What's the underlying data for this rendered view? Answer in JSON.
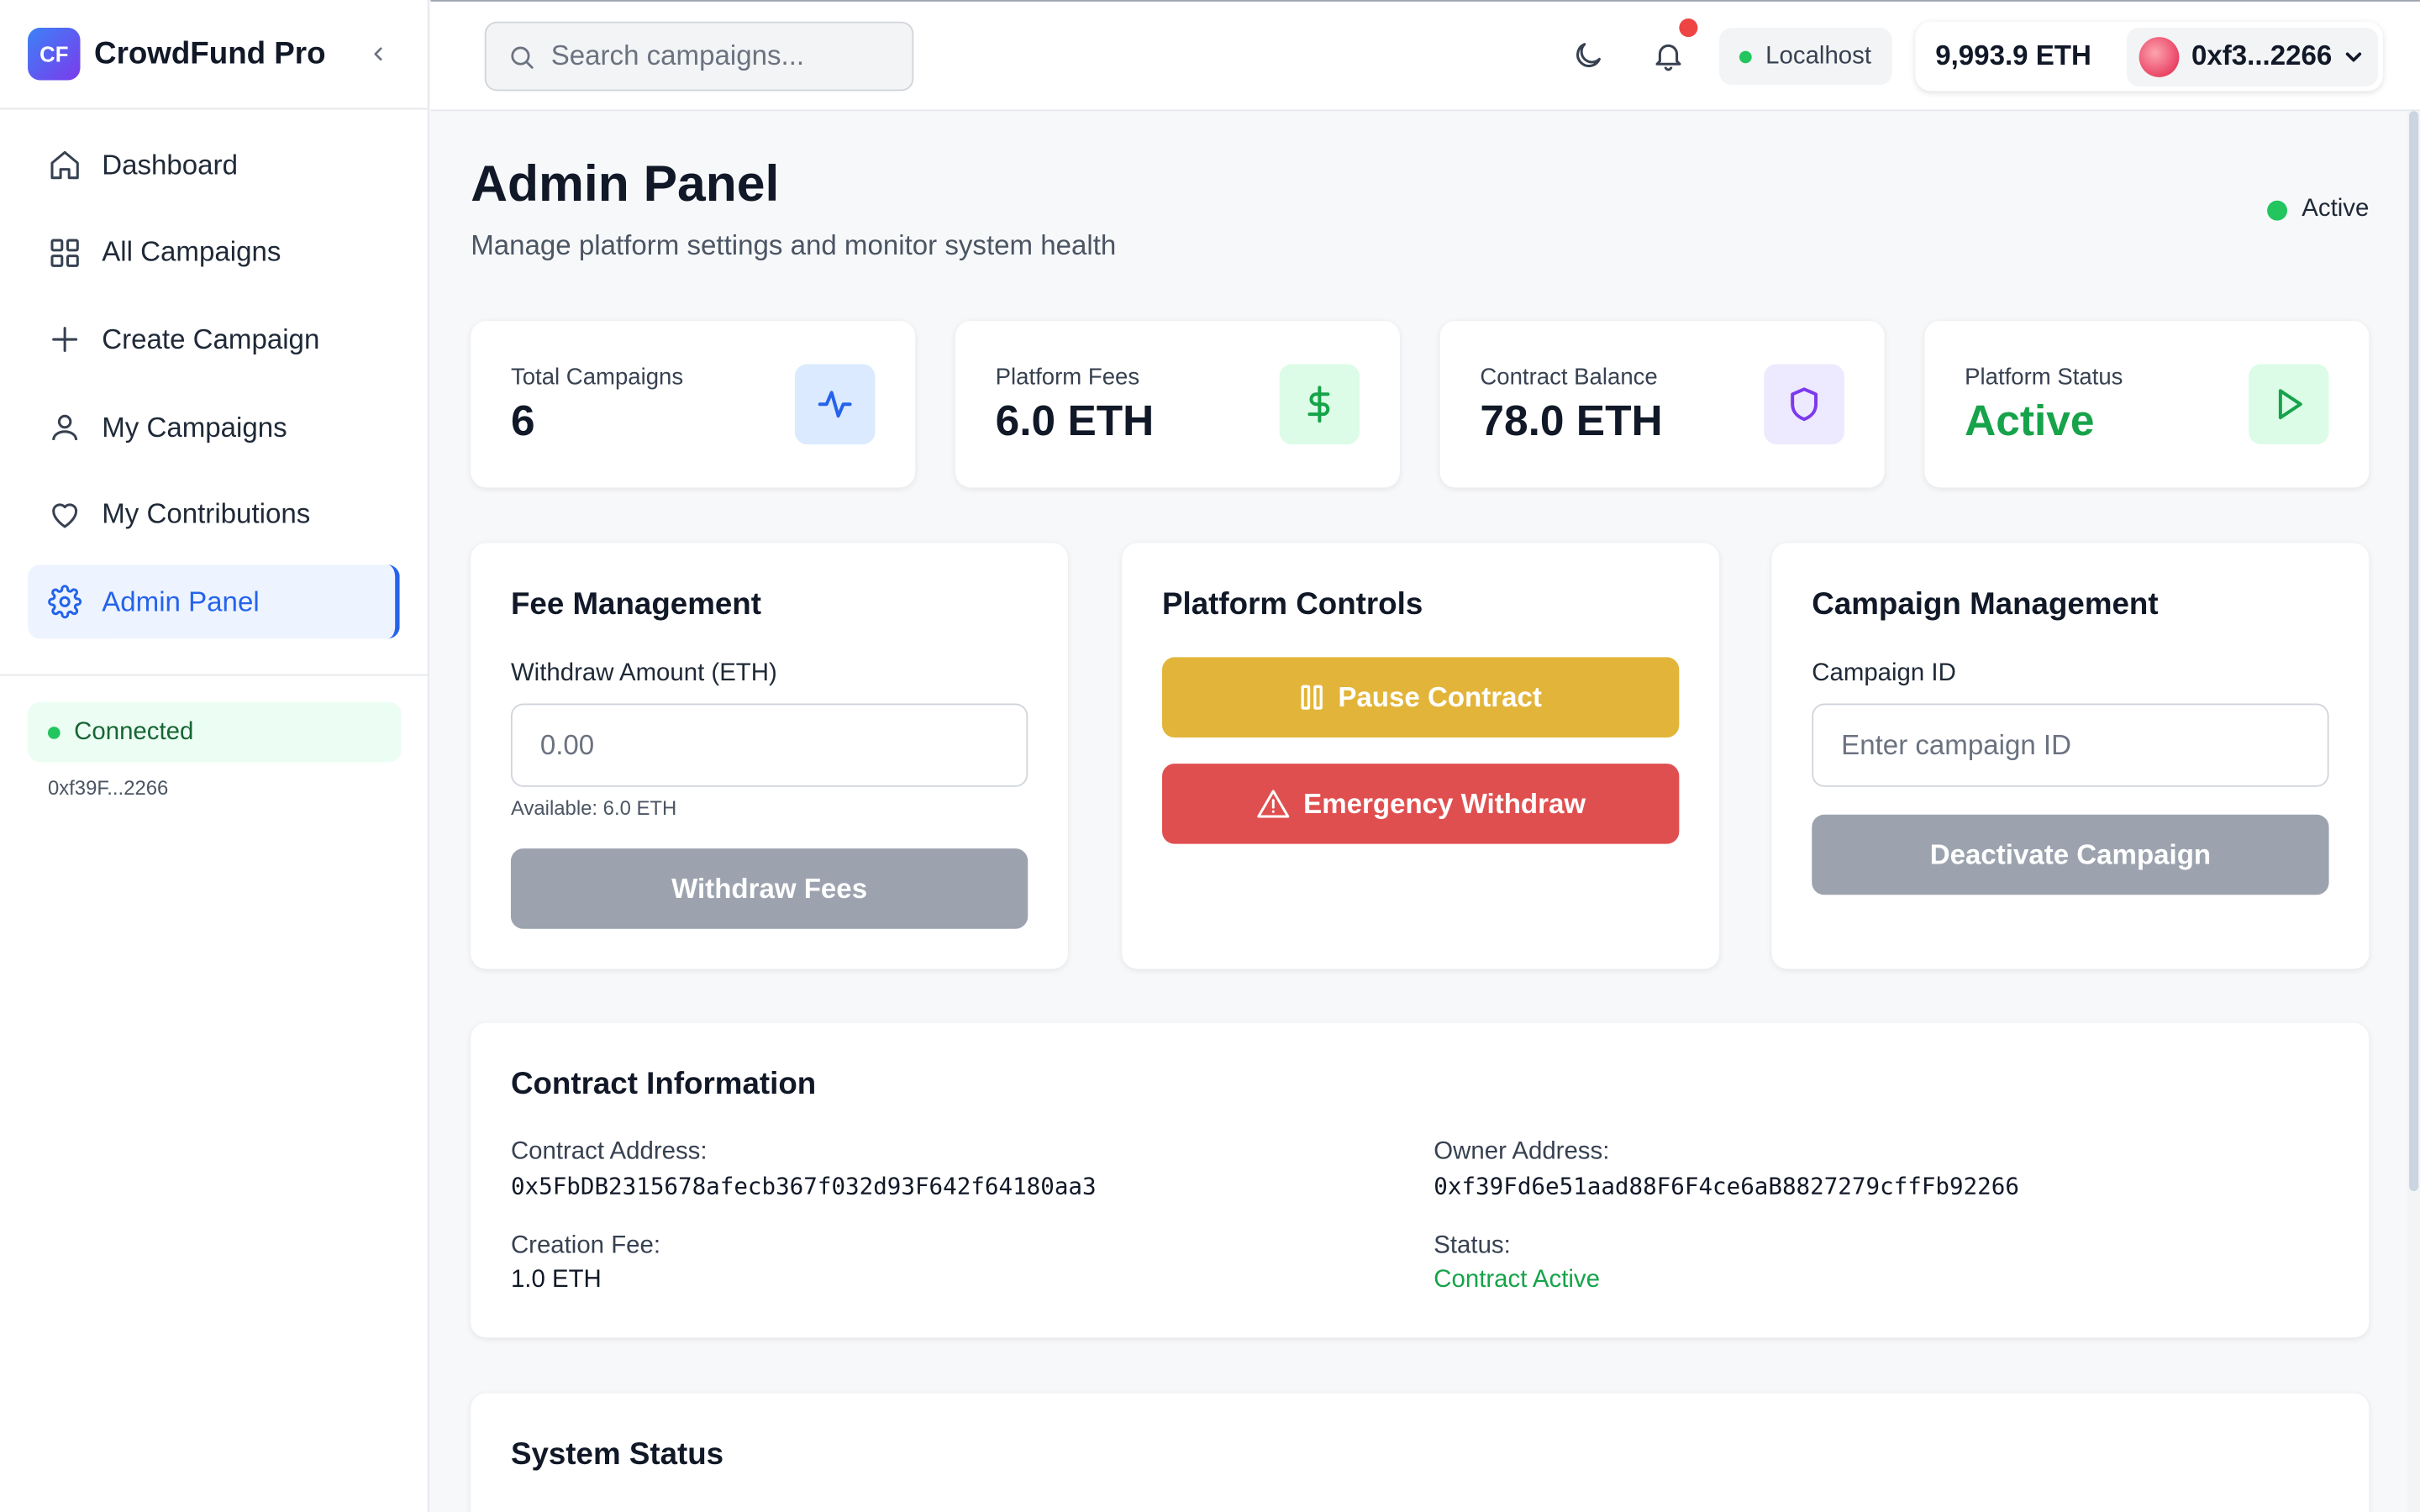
{
  "brand": {
    "logo_text": "CF",
    "name": "CrowdFund Pro"
  },
  "sidebar": {
    "items": [
      {
        "label": "Dashboard",
        "icon": "home-icon"
      },
      {
        "label": "All Campaigns",
        "icon": "grid-icon"
      },
      {
        "label": "Create Campaign",
        "icon": "plus-icon"
      },
      {
        "label": "My Campaigns",
        "icon": "user-icon"
      },
      {
        "label": "My Contributions",
        "icon": "heart-icon"
      },
      {
        "label": "Admin Panel",
        "icon": "gear-icon",
        "active": true
      }
    ],
    "connection_status": "Connected",
    "connected_address": "0xf39F...2266"
  },
  "topbar": {
    "search_placeholder": "Search campaigns...",
    "network": "Localhost",
    "balance": "9,993.9 ETH",
    "account": "0xf3...2266"
  },
  "page": {
    "title": "Admin Panel",
    "subtitle": "Manage platform settings and monitor system health",
    "status": "Active"
  },
  "stats": [
    {
      "label": "Total Campaigns",
      "value": "6",
      "icon": "activity-icon",
      "icon_color": "#2563eb",
      "icon_bg": "#dbeafe"
    },
    {
      "label": "Platform Fees",
      "value": "6.0 ETH",
      "icon": "dollar-icon",
      "icon_color": "#16a34a",
      "icon_bg": "#dcfce7"
    },
    {
      "label": "Contract Balance",
      "value": "78.0 ETH",
      "icon": "shield-icon",
      "icon_color": "#7c3aed",
      "icon_bg": "#ede9fe"
    },
    {
      "label": "Platform Status",
      "value": "Active",
      "icon": "play-icon",
      "icon_color": "#16a34a",
      "icon_bg": "#dcfce7"
    }
  ],
  "fee_management": {
    "title": "Fee Management",
    "field_label": "Withdraw Amount (ETH)",
    "placeholder": "0.00",
    "available": "Available: 6.0 ETH",
    "button": "Withdraw Fees"
  },
  "platform_controls": {
    "title": "Platform Controls",
    "pause_button": "Pause Contract",
    "emergency_button": "Emergency Withdraw"
  },
  "campaign_management": {
    "title": "Campaign Management",
    "field_label": "Campaign ID",
    "placeholder": "Enter campaign ID",
    "button": "Deactivate Campaign"
  },
  "contract_info": {
    "title": "Contract Information",
    "contract_address_label": "Contract Address:",
    "contract_address": "0x5FbDB2315678afecb367f032d93F642f64180aa3",
    "owner_address_label": "Owner Address:",
    "owner_address": "0xf39Fd6e51aad88F6F4ce6aB8827279cffFb92266",
    "creation_fee_label": "Creation Fee:",
    "creation_fee": "1.0 ETH",
    "status_label": "Status:",
    "status": "Contract Active"
  },
  "system_status": {
    "title": "System Status"
  },
  "colors": {
    "accent": "#2563eb",
    "success": "#16a34a",
    "warning": "#e2b53a",
    "danger": "#e04f4f",
    "disabled": "#9ca3af"
  }
}
